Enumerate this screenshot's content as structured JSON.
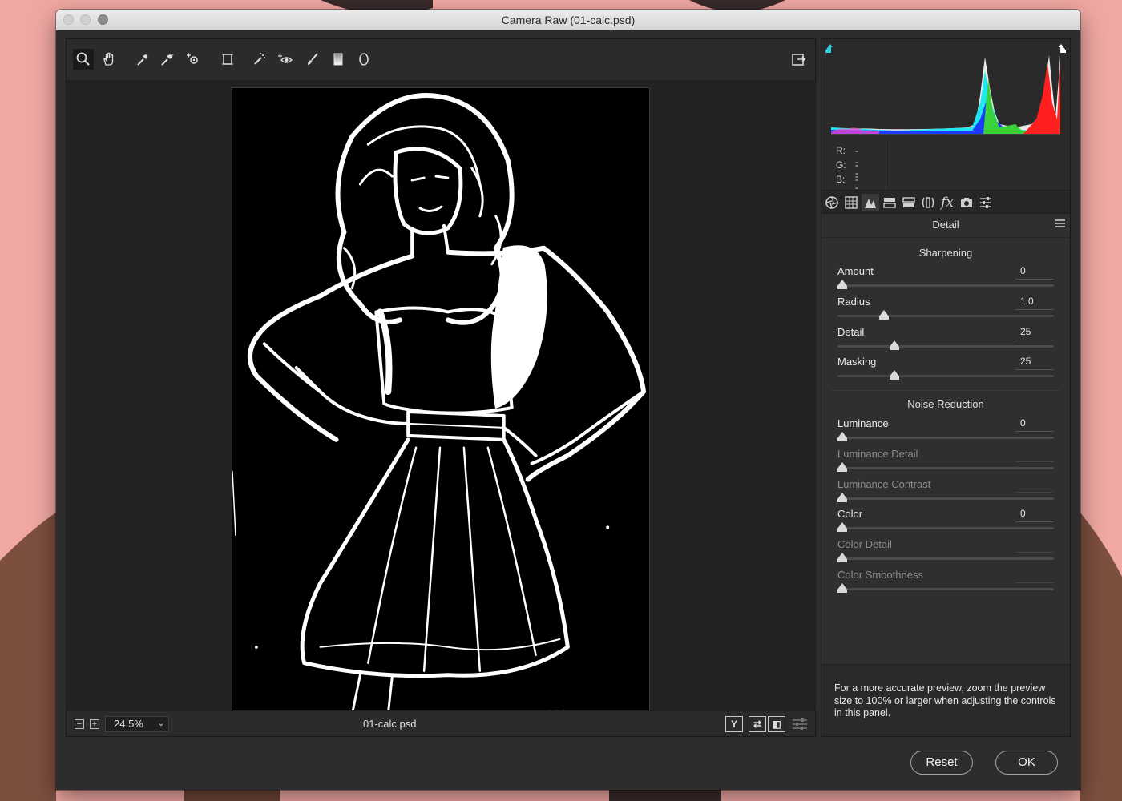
{
  "window": {
    "title": "Camera Raw (01-calc.psd)"
  },
  "toolbar": {
    "tools": [
      {
        "name": "zoom-tool"
      },
      {
        "name": "hand-tool"
      },
      {
        "name": "white-balance-tool"
      },
      {
        "name": "color-sampler-tool"
      },
      {
        "name": "targeted-adjustment-tool"
      },
      {
        "name": "transform-tool"
      },
      {
        "name": "spot-removal-tool"
      },
      {
        "name": "red-eye-removal-tool"
      },
      {
        "name": "adjustment-brush-tool"
      },
      {
        "name": "graduated-filter-tool"
      },
      {
        "name": "radial-filter-tool"
      }
    ],
    "fullscreen_icon": "fullscreen-icon"
  },
  "statusbar": {
    "zoom_value": "24.5%",
    "filename": "01-calc.psd",
    "view_buttons": [
      "Y",
      "⇄",
      "◧"
    ]
  },
  "readout": {
    "r_label": "R:",
    "r_value": "---",
    "g_label": "G:",
    "g_value": "---",
    "b_label": "B:",
    "b_value": "---"
  },
  "panel": {
    "title": "Detail",
    "sharpening_title": "Sharpening",
    "noise_title": "Noise Reduction",
    "sharpening": [
      {
        "label": "Amount",
        "value": "0",
        "level": 0.0,
        "enabled": true
      },
      {
        "label": "Radius",
        "value": "1.0",
        "level": 0.2,
        "enabled": true
      },
      {
        "label": "Detail",
        "value": "25",
        "level": 0.25,
        "enabled": true
      },
      {
        "label": "Masking",
        "value": "25",
        "level": 0.25,
        "enabled": true
      }
    ],
    "noise": [
      {
        "label": "Luminance",
        "value": "0",
        "level": 0.0,
        "enabled": true
      },
      {
        "label": "Luminance Detail",
        "value": "",
        "level": 0.0,
        "enabled": false
      },
      {
        "label": "Luminance Contrast",
        "value": "",
        "level": 0.0,
        "enabled": false
      },
      {
        "label": "Color",
        "value": "0",
        "level": 0.0,
        "enabled": true
      },
      {
        "label": "Color Detail",
        "value": "",
        "level": 0.0,
        "enabled": false
      },
      {
        "label": "Color Smoothness",
        "value": "",
        "level": 0.0,
        "enabled": false
      }
    ],
    "info_text": "For a more accurate preview, zoom the preview size to 100% or larger when adjusting the controls in this panel."
  },
  "buttons": {
    "reset": "Reset",
    "ok": "OK"
  },
  "colors": {
    "accent_clip_shadow": "#2fd0e6",
    "accent_clip_highlight": "#ffffff"
  }
}
